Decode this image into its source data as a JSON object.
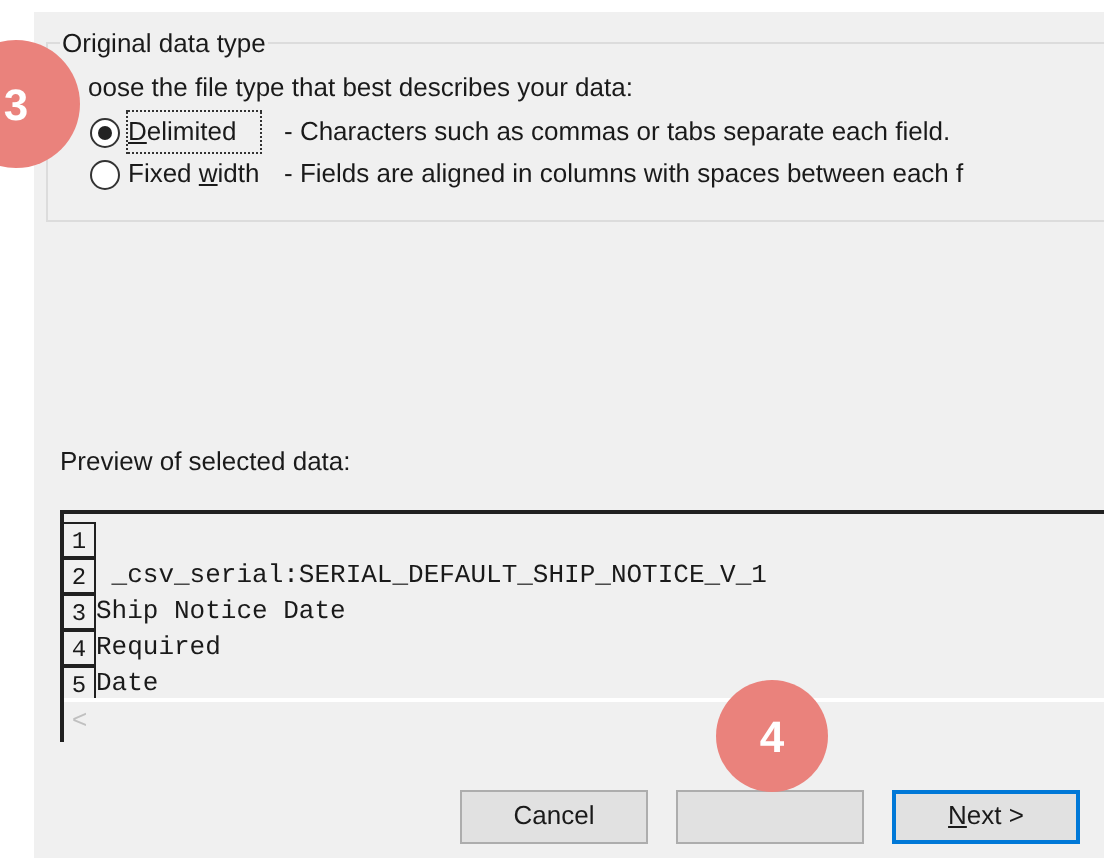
{
  "group": {
    "title": "Original data type",
    "prompt": "oose the file type that best describes your data:",
    "options": [
      {
        "label": {
          "key": "D",
          "after": "elimited"
        },
        "description": "- Characters such as commas or tabs separate each field.",
        "selected": true
      },
      {
        "label": {
          "before": "Fixed ",
          "key": "w",
          "after": "idth"
        },
        "description": "- Fields are aligned in columns with spaces between each f",
        "selected": false
      }
    ]
  },
  "preview": {
    "title": "Preview of selected data:",
    "rows": [
      {
        "number": "1"
      },
      {
        "number": "2",
        "text": " _csv_serial:SERIAL_DEFAULT_SHIP_NOTICE_V_1"
      },
      {
        "number": "3",
        "text": "Ship Notice Date"
      },
      {
        "number": "4",
        "text": "Required"
      },
      {
        "number": "5",
        "text": "Date"
      }
    ],
    "scroll_left": "<"
  },
  "buttons": [
    {
      "label": {
        "before": "Cancel"
      },
      "default": false
    },
    {
      "default": false
    },
    {
      "label": {
        "key": "N",
        "after": "ext >"
      },
      "default": true
    }
  ],
  "callouts": [
    {
      "label": "3"
    },
    {
      "label": "4"
    }
  ]
}
